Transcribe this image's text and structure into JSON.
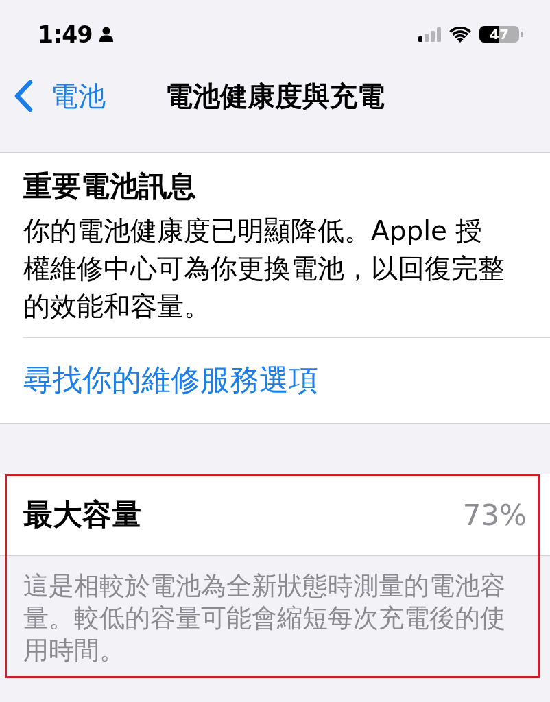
{
  "status_bar": {
    "time": "1:49",
    "battery": "47"
  },
  "nav": {
    "back": "電池",
    "title": "電池健康度與充電"
  },
  "sections": [
    {
      "kind": "notice",
      "title": "重要電池訊息",
      "body": "你的電池健康度已明顯降低。Apple 授權維修中心可為你更換電池，以回復完整的效能和容量。",
      "link": "尋找你的維修服務選項"
    },
    {
      "kind": "metric",
      "label": "最大容量",
      "value": "73%",
      "highlighted": true,
      "footer": "這是相較於電池為全新狀態時測量的電池容量。較低的容量可能會縮短每次充電後的使用時間。"
    }
  ]
}
